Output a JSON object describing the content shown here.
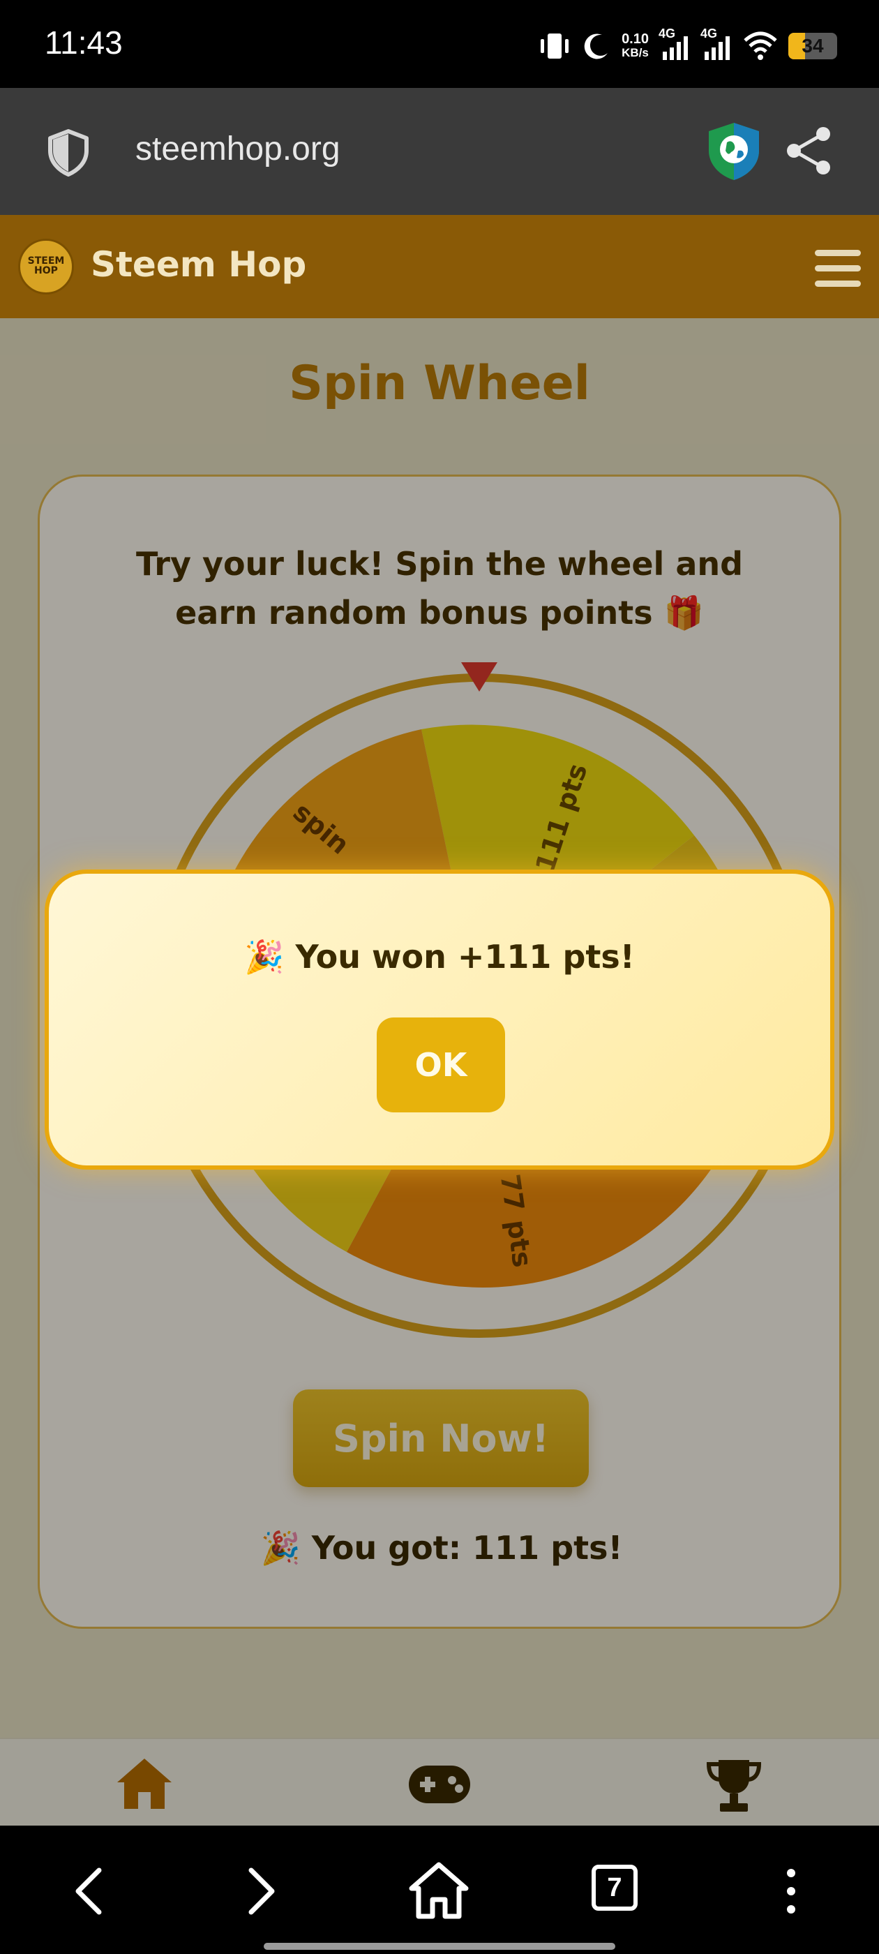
{
  "status_bar": {
    "time": "11:43",
    "net_speed_value": "0.10",
    "net_speed_unit": "KB/s",
    "sim1_label": "4G",
    "sim2_label": "4G",
    "battery_level": "34",
    "icons": [
      "vibrate-icon",
      "moon-icon",
      "signal-icon",
      "signal-icon",
      "wifi-icon",
      "battery-icon"
    ]
  },
  "browser": {
    "url": "steemhop.org",
    "icons": [
      "shield-icon",
      "vpn-globe-icon",
      "share-icon"
    ]
  },
  "site": {
    "name": "Steem Hop",
    "logo_text_line1": "STEEM",
    "logo_text_line2": "HOP"
  },
  "main": {
    "title": "Spin Wheel",
    "intro": "Try your luck! Spin the wheel and earn random bonus points 🎁",
    "wheel_labels": [
      "111 pts",
      "77 pts",
      "spin"
    ],
    "spin_button": "Spin Now!",
    "result": "🎉 You got: 111 pts!"
  },
  "modal": {
    "message": "🎉 You won +111 pts!",
    "ok_label": "OK"
  },
  "bottom_nav": {
    "items": [
      "home-icon",
      "gamepad-icon",
      "trophy-icon"
    ]
  },
  "android_nav": {
    "tab_count": "7"
  },
  "colors": {
    "header": "#8a5a06",
    "accent": "#e7b20c",
    "title": "#b97b08",
    "wheel_border": "#d9a21a"
  }
}
